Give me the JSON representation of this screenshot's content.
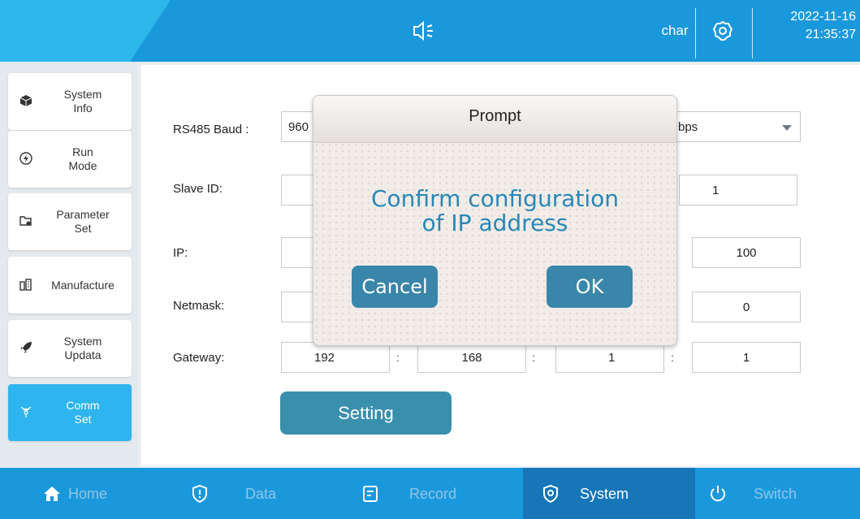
{
  "header": {
    "user": "char",
    "date": "2022-11-16",
    "time": "21:35:37"
  },
  "sidebar": {
    "items": [
      {
        "label": "System\nInfo",
        "icon": "cube-icon"
      },
      {
        "label": "Run\nMode",
        "icon": "lightning-icon"
      },
      {
        "label": "Parameter\nSet",
        "icon": "folder-gear-icon"
      },
      {
        "label": "Manufacture",
        "icon": "factory-icon"
      },
      {
        "label": "System\nUpdata",
        "icon": "rocket-icon"
      },
      {
        "label": "Comm\nSet",
        "icon": "signal-icon",
        "active": true
      }
    ]
  },
  "form": {
    "baud_label": "RS485 Baud :",
    "baud_value": "960",
    "baud_unit": "bps",
    "slave_label": "Slave ID:",
    "slave_value": "1",
    "ip_label": "IP:",
    "ip_last": "100",
    "netmask_label": "Netmask:",
    "netmask_last": "0",
    "gateway_label": "Gateway:",
    "gateway": [
      "192",
      "168",
      "1",
      "1"
    ],
    "separator": ":",
    "setting_button": "Setting"
  },
  "modal": {
    "title": "Prompt",
    "message_line1": "Confirm configuration",
    "message_line2": "of IP address",
    "cancel_label": "Cancel",
    "ok_label": "OK"
  },
  "bottom_nav": {
    "items": [
      {
        "label": "Home",
        "icon": "home-icon"
      },
      {
        "label": "Data",
        "icon": "shield-icon"
      },
      {
        "label": "Record",
        "icon": "record-icon"
      },
      {
        "label": "System",
        "icon": "system-gear-icon",
        "active": true
      },
      {
        "label": "Switch",
        "icon": "power-icon"
      }
    ]
  },
  "colors": {
    "header_blue": "#1a98dc",
    "accent_light_blue": "#2bb7ea",
    "active_sidebar": "#2eb4ee",
    "active_nav": "#1676b7",
    "button_teal": "#3a86aa",
    "modal_text": "#2a87b5"
  }
}
